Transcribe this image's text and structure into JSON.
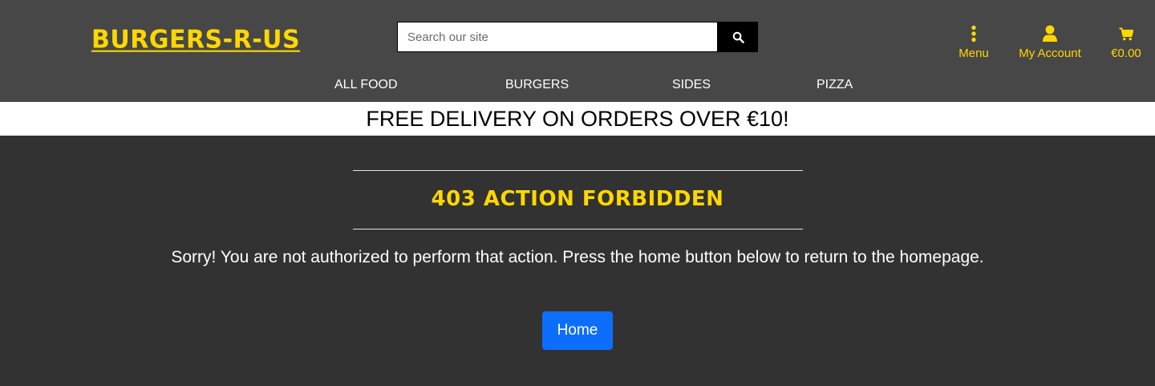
{
  "header": {
    "logo": "BURGERS-R-US",
    "search": {
      "placeholder": "Search our site",
      "value": ""
    },
    "menu_label": "Menu",
    "account_label": "My Account",
    "cart_total": "€0.00"
  },
  "nav": {
    "items": [
      "ALL FOOD",
      "BURGERS",
      "SIDES",
      "PIZZA"
    ]
  },
  "banner": "FREE DELIVERY ON ORDERS OVER €10!",
  "main": {
    "heading": "403 ACTION FORBIDDEN",
    "message": "Sorry! You are not authorized to perform that action. Press the home button below to return to the homepage.",
    "home_button": "Home"
  },
  "colors": {
    "accent": "#ffd700",
    "header_bg": "#474747",
    "page_bg": "#323232",
    "button_primary": "#0d6efd"
  },
  "icons": [
    "search-icon",
    "vertical-dots-icon",
    "user-icon",
    "cart-icon"
  ]
}
